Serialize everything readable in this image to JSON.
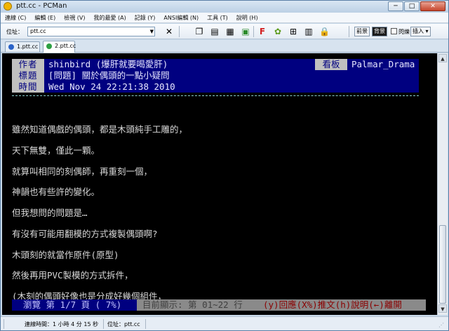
{
  "window": {
    "title": "ptt.cc - PCMan"
  },
  "menu": [
    "連線 (C)",
    "編輯 (E)",
    "檢視 (V)",
    "我的最愛 (A)",
    "記錄 (Y)",
    "ANSI編輯 (N)",
    "工具 (T)",
    "說明 (H)"
  ],
  "toolbar": {
    "address_label": "位址：",
    "address_value": "ptt.cc",
    "btn_prev": "前景",
    "btn_bg": "背景",
    "btn_blink": "閃爍",
    "btn_insert": "插入"
  },
  "tabs": [
    {
      "label": "1.ptt.cc"
    },
    {
      "label": "2.ptt.cc"
    }
  ],
  "article": {
    "author_label": "作者",
    "author_value": "shinbird (爆肝就要喝愛肝)",
    "board_label": "看板",
    "board_value": "Palmar_Drama",
    "title_label": "標題",
    "title_value": "[問題] 關於偶頭的一點小疑問",
    "time_label": "時間",
    "time_value": "Wed Nov 24 22:21:38 2010",
    "lines": [
      "雖然知道偶戲的偶頭，都是木頭純手工雕的，",
      "天下無雙，僅此一顆。",
      "就算叫相同的刻偶師，再重刻一個，",
      "神韻也有些許的變化。",
      "但我想問的問題是…",
      "有沒有可能用翻模的方式複製偶頭啊?",
      "木頭刻的就當作原件(原型)",
      "然後再用PVC製模的方式拆件，",
      "(木刻的偶頭好像也是分成好幾個組件，"
    ]
  },
  "footer": {
    "browse": "瀏覽 第 1/7 頁 ( 7%)",
    "range": "目前顯示: 第 01~22 行",
    "keys": "(y)回應(X%)推文(h)說明(←)離開"
  },
  "statusbar": {
    "elapsed": "連線時間：1 小時 4 分 15 秒",
    "address": "位址：ptt.cc"
  },
  "colors": {
    "header_bg": "#000080",
    "label_bg": "#c0c0c0",
    "terminal_bg": "#000000"
  }
}
